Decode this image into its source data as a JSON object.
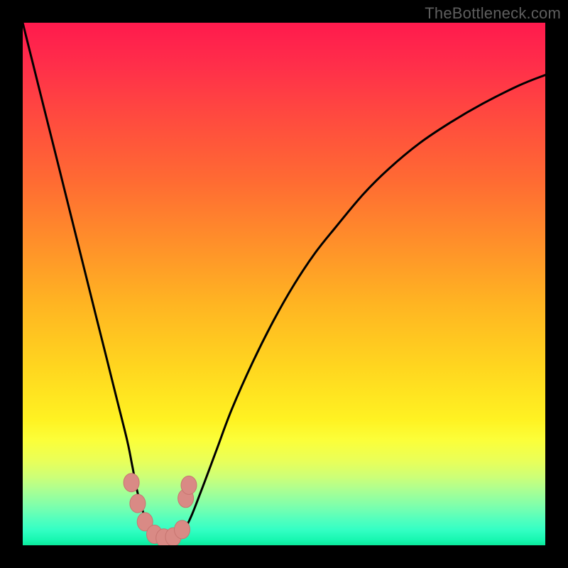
{
  "watermark": "TheBottleneck.com",
  "colors": {
    "frame": "#000000",
    "curve": "#000000",
    "marker_fill": "#d98a85",
    "marker_stroke": "#c77570"
  },
  "chart_data": {
    "type": "line",
    "title": "",
    "xlabel": "",
    "ylabel": "",
    "xlim": [
      0,
      100
    ],
    "ylim": [
      0,
      100
    ],
    "grid": false,
    "legend": false,
    "series": [
      {
        "name": "bottleneck-curve",
        "x": [
          0,
          2,
          4,
          6,
          8,
          10,
          12,
          14,
          16,
          18,
          20,
          21,
          22,
          23.5,
          25,
          27,
          29,
          30.5,
          32,
          34,
          37,
          40,
          44,
          48,
          52,
          56,
          60,
          65,
          70,
          76,
          82,
          88,
          95,
          100
        ],
        "y": [
          100,
          92,
          84,
          76,
          68,
          60,
          52,
          44,
          36,
          28,
          20,
          15,
          10,
          5,
          2,
          1,
          1,
          2.5,
          5,
          10,
          18,
          26,
          35,
          43,
          50,
          56,
          61,
          67,
          72,
          77,
          81,
          84.5,
          88,
          90
        ]
      }
    ],
    "markers": [
      {
        "x": 20.8,
        "y": 12.0
      },
      {
        "x": 22.0,
        "y": 8.0
      },
      {
        "x": 23.4,
        "y": 4.5
      },
      {
        "x": 25.2,
        "y": 2.1
      },
      {
        "x": 27.0,
        "y": 1.4
      },
      {
        "x": 28.8,
        "y": 1.6
      },
      {
        "x": 30.5,
        "y": 3.0
      },
      {
        "x": 31.2,
        "y": 9.0
      },
      {
        "x": 31.8,
        "y": 11.5
      }
    ]
  }
}
